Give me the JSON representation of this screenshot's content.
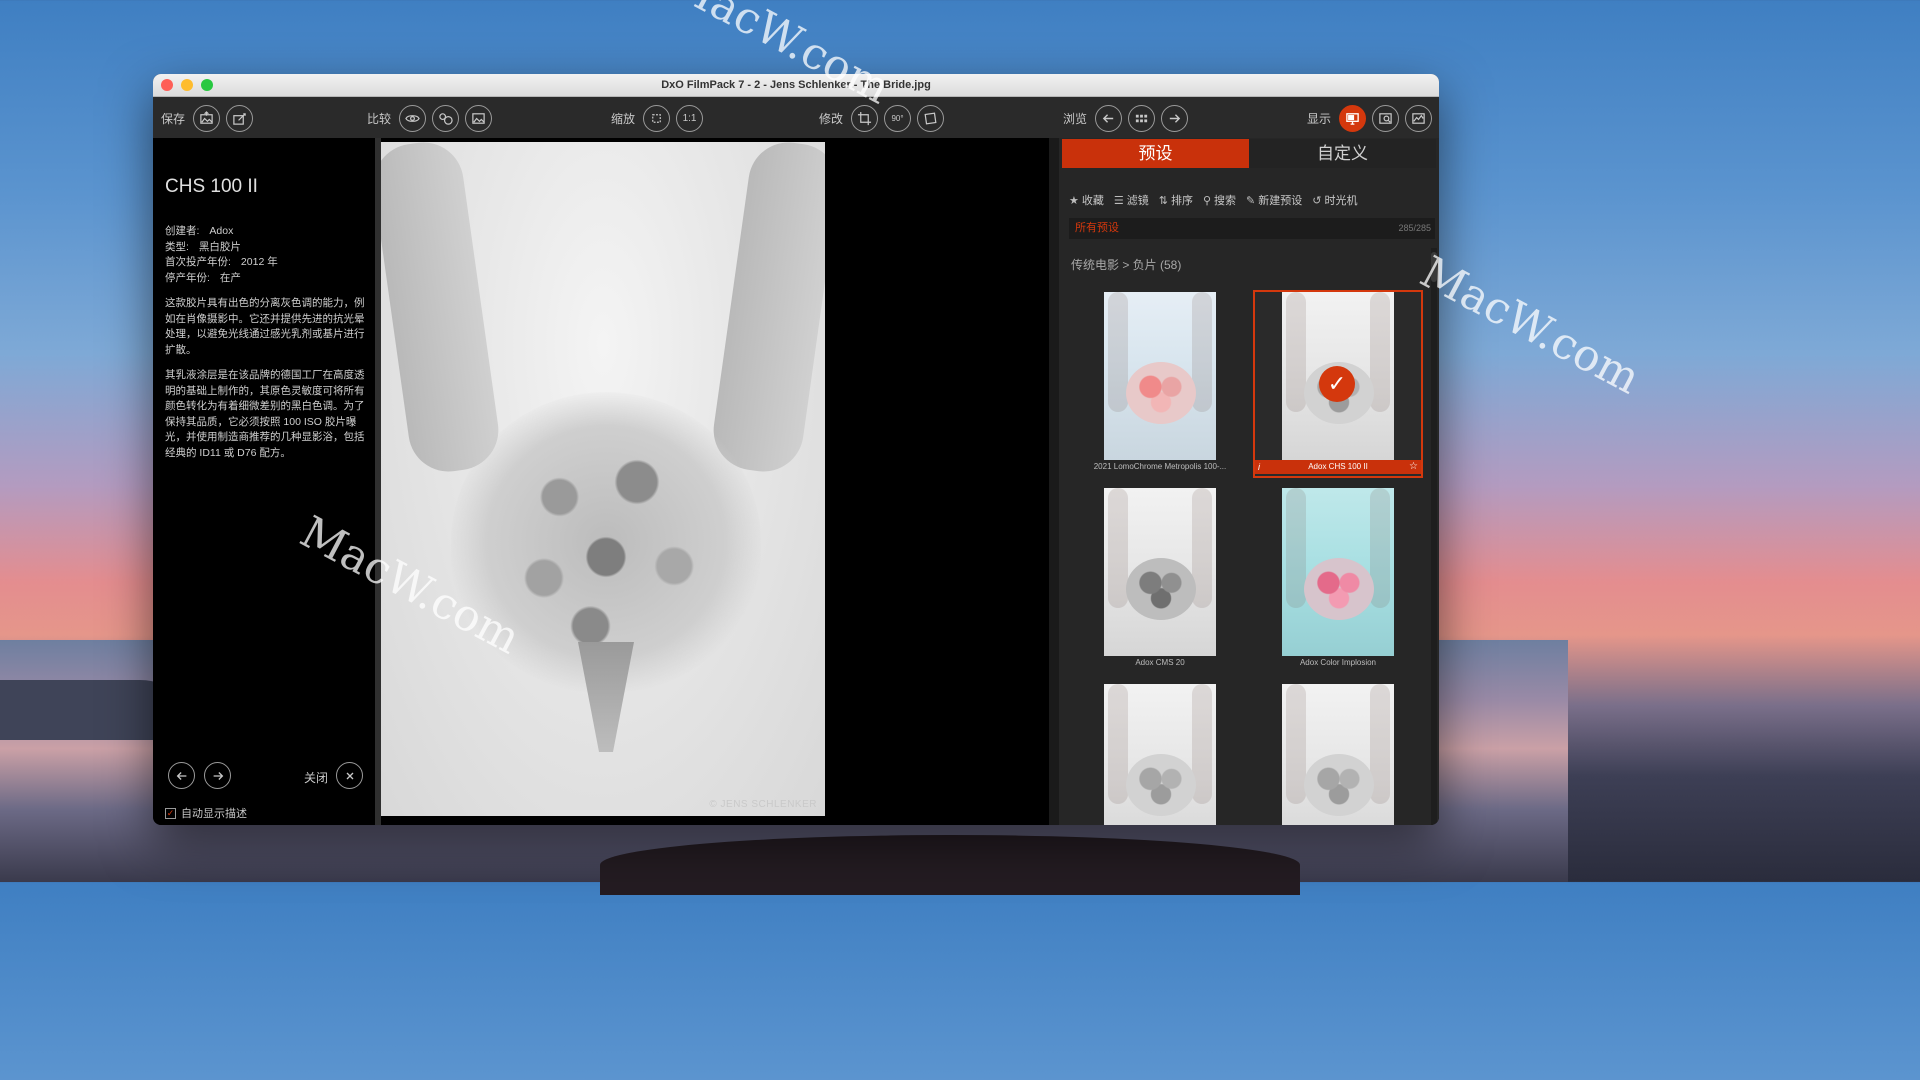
{
  "window": {
    "title": "DxO FilmPack 7 - 2 - Jens Schlenker - The Bride.jpg"
  },
  "toolbar": {
    "save_label": "保存",
    "compare_label": "比较",
    "zoom_label": "缩放",
    "zoom_1to1": "1:1",
    "edit_label": "修改",
    "rotate_label": "90°",
    "browse_label": "浏览",
    "display_label": "显示"
  },
  "description": {
    "film_name": "CHS 100 II",
    "creator_label": "创建者:",
    "creator_value": "Adox",
    "type_label": "类型:",
    "type_value": "黑白胶片",
    "first_year_label": "首次投产年份:",
    "first_year_value": "2012 年",
    "end_year_label": "停产年份:",
    "end_year_value": "在产",
    "paragraph1": "这款胶片具有出色的分离灰色调的能力，例如在肖像摄影中。它还并提供先进的抗光晕处理，以避免光线通过感光乳剂或基片进行扩散。",
    "paragraph2": "其乳液涂层是在该品牌的德国工厂在高度透明的基础上制作的，其原色灵敏度可将所有颜色转化为有着细微差别的黑白色调。为了保持其品质，它必须按照 100 ISO 胶片曝光，并使用制造商推荐的几种显影浴，包括经典的 ID11 或 D76 配方。",
    "close_label": "关闭",
    "auto_show_label": "自动显示描述"
  },
  "photo": {
    "copyright": "© JENS SCHLENKER"
  },
  "presets_panel": {
    "tabs": [
      {
        "label": "预设",
        "active": true
      },
      {
        "label": "自定义",
        "active": false
      }
    ],
    "filters": {
      "favorites": "收藏",
      "filter": "滤镜",
      "sort": "排序",
      "search": "搜索",
      "new_preset": "新建预设",
      "time_machine": "时光机"
    },
    "all_presets_label": "所有预设",
    "count": "285/285",
    "breadcrumb": "传统电影 > 负片 (58)",
    "presets": [
      {
        "name": "2021 LomoChrome Metropolis 100-...",
        "style": "color",
        "selected": false
      },
      {
        "name": "Adox CHS 100 II",
        "style": "bw",
        "selected": true
      },
      {
        "name": "Adox CMS 20",
        "style": "bw-dark",
        "selected": false
      },
      {
        "name": "Adox Color Implosion",
        "style": "cyan",
        "selected": false
      },
      {
        "name": "",
        "style": "bw",
        "selected": false
      },
      {
        "name": "",
        "style": "bw",
        "selected": false
      }
    ]
  },
  "watermark_text": "MacW.com",
  "colors": {
    "accent": "#d4380d",
    "panel": "#262626",
    "titlebar": "#e6e6e6"
  }
}
